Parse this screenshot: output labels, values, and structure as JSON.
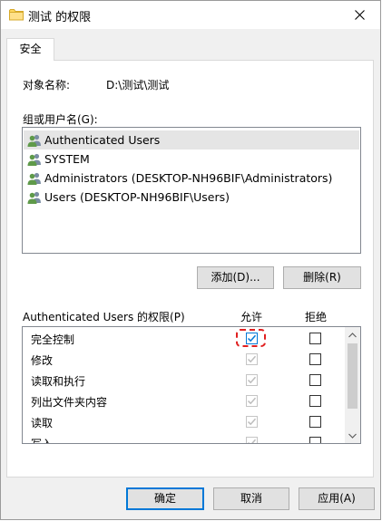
{
  "window": {
    "title": "测试 的权限",
    "folder_icon": "folder-icon",
    "close_icon": "close-icon"
  },
  "tabs": [
    {
      "label": "安全",
      "active": true
    }
  ],
  "object": {
    "label": "对象名称:",
    "value": "D:\\测试\\测试"
  },
  "users": {
    "label": "组或用户名(G):",
    "items": [
      {
        "label": "Authenticated Users",
        "selected": true,
        "icon": "users-group-icon"
      },
      {
        "label": "SYSTEM",
        "selected": false,
        "icon": "users-group-icon"
      },
      {
        "label": "Administrators (DESKTOP-NH96BIF\\Administrators)",
        "selected": false,
        "icon": "users-group-icon"
      },
      {
        "label": "Users (DESKTOP-NH96BIF\\Users)",
        "selected": false,
        "icon": "users-group-icon"
      }
    ],
    "add_button": "添加(D)...",
    "remove_button": "删除(R)"
  },
  "permissions": {
    "label": "Authenticated Users 的权限(P)",
    "allow_header": "允许",
    "deny_header": "拒绝",
    "items": [
      {
        "name": "完全控制",
        "allow": true,
        "allow_enabled": true,
        "deny": false,
        "highlighted": true
      },
      {
        "name": "修改",
        "allow": true,
        "allow_enabled": false,
        "deny": false
      },
      {
        "name": "读取和执行",
        "allow": true,
        "allow_enabled": false,
        "deny": false
      },
      {
        "name": "列出文件夹内容",
        "allow": true,
        "allow_enabled": false,
        "deny": false
      },
      {
        "name": "读取",
        "allow": true,
        "allow_enabled": false,
        "deny": false
      },
      {
        "name": "写入",
        "allow": true,
        "allow_enabled": false,
        "deny": false
      }
    ]
  },
  "buttons": {
    "ok": "确定",
    "cancel": "取消",
    "apply": "应用(A)"
  },
  "colors": {
    "accent": "#0078d7",
    "highlight_ring": "#e02020",
    "selection": "#e5e5e5"
  }
}
